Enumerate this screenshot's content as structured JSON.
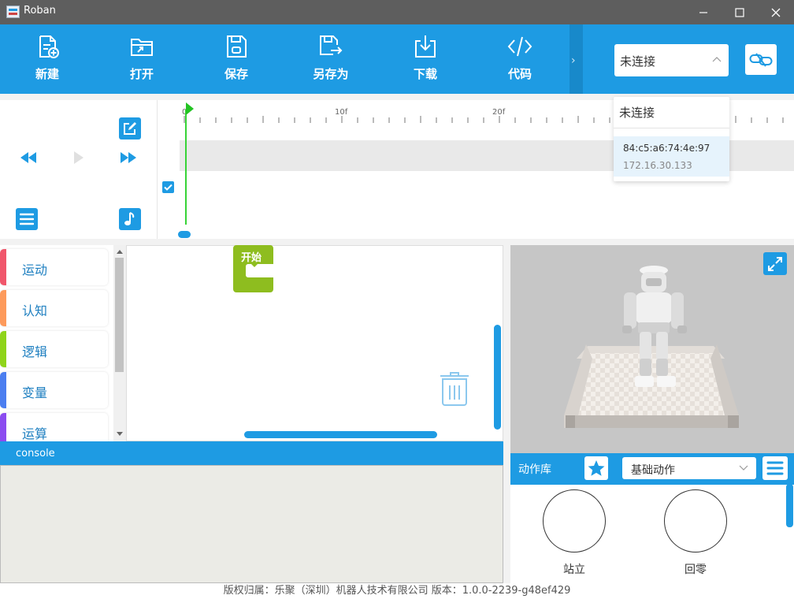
{
  "window": {
    "title": "Roban"
  },
  "toolbar": {
    "buttons": [
      {
        "label": "新建",
        "icon": "new-file-icon"
      },
      {
        "label": "打开",
        "icon": "open-folder-icon"
      },
      {
        "label": "保存",
        "icon": "save-icon"
      },
      {
        "label": "另存为",
        "icon": "save-as-icon"
      },
      {
        "label": "下载",
        "icon": "download-icon"
      },
      {
        "label": "代码",
        "icon": "code-icon"
      }
    ],
    "expand_arrow": "›",
    "connection": {
      "value": "未连接"
    }
  },
  "connection_dropdown": {
    "header": "未连接",
    "devices": [
      {
        "mac": "84:c5:a6:74:4e:97",
        "ip": "172.16.30.133"
      }
    ]
  },
  "timeline": {
    "ruler_labels": [
      "0",
      "10f",
      "20f"
    ],
    "checkbox_checked": true
  },
  "categories": [
    {
      "label": "运动",
      "color": "#f0566b"
    },
    {
      "label": "认知",
      "color": "#fd9a5b"
    },
    {
      "label": "逻辑",
      "color": "#8fd41a"
    },
    {
      "label": "变量",
      "color": "#4b7ef0"
    },
    {
      "label": "运算",
      "color": "#8b4cf0"
    }
  ],
  "workspace": {
    "start_block_label": "开始"
  },
  "console": {
    "title": "console"
  },
  "action_library": {
    "title": "动作库",
    "selected_library": "基础动作",
    "actions": [
      {
        "label": "站立"
      },
      {
        "label": "回零"
      }
    ]
  },
  "footer": {
    "text": "版权归属：乐聚（深圳）机器人技术有限公司 版本：1.0.0-2239-g48ef429"
  },
  "colors": {
    "accent": "#1e9be3",
    "titlebar": "#5e5e5e",
    "playhead": "#37d337",
    "start_block": "#8ebd1f"
  }
}
